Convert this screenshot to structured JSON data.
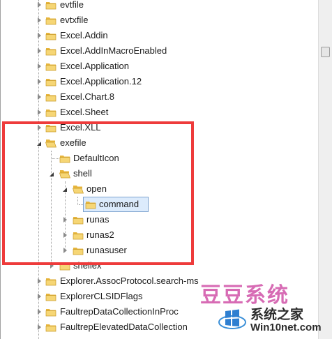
{
  "tree": {
    "items": [
      {
        "label": "evtfile",
        "state": "collapsed"
      },
      {
        "label": "evtxfile",
        "state": "collapsed"
      },
      {
        "label": "Excel.Addin",
        "state": "collapsed"
      },
      {
        "label": "Excel.AddInMacroEnabled",
        "state": "collapsed"
      },
      {
        "label": "Excel.Application",
        "state": "collapsed"
      },
      {
        "label": "Excel.Application.12",
        "state": "collapsed"
      },
      {
        "label": "Excel.Chart.8",
        "state": "collapsed"
      },
      {
        "label": "Excel.Sheet",
        "state": "collapsed"
      },
      {
        "label": "Excel.XLL",
        "state": "collapsed"
      },
      {
        "label": "exefile",
        "state": "expanded"
      },
      {
        "label": "DefaultIcon",
        "state": "leaf"
      },
      {
        "label": "shell",
        "state": "expanded"
      },
      {
        "label": "open",
        "state": "expanded"
      },
      {
        "label": "command",
        "state": "selected"
      },
      {
        "label": "runas",
        "state": "collapsed"
      },
      {
        "label": "runas2",
        "state": "collapsed"
      },
      {
        "label": "runasuser",
        "state": "collapsed"
      },
      {
        "label": "shellex",
        "state": "collapsed"
      },
      {
        "label": "Explorer.AssocProtocol.search-ms",
        "state": "collapsed"
      },
      {
        "label": "ExplorerCLSIDFlags",
        "state": "collapsed"
      },
      {
        "label": "FaultrepDataCollectionInProc",
        "state": "collapsed"
      },
      {
        "label": "FaultrepElevatedDataCollection",
        "state": "collapsed"
      }
    ]
  },
  "watermark": {
    "line1": "豆豆系统",
    "line2": "系统之家",
    "url": "Win10net.com",
    "accent": "#d76bb4"
  },
  "colors": {
    "highlight_box": "#ee3b3b",
    "selection_bg": "#dcebfc",
    "selection_border": "#7da2ce",
    "folder_yellow": "#f2c94c"
  }
}
